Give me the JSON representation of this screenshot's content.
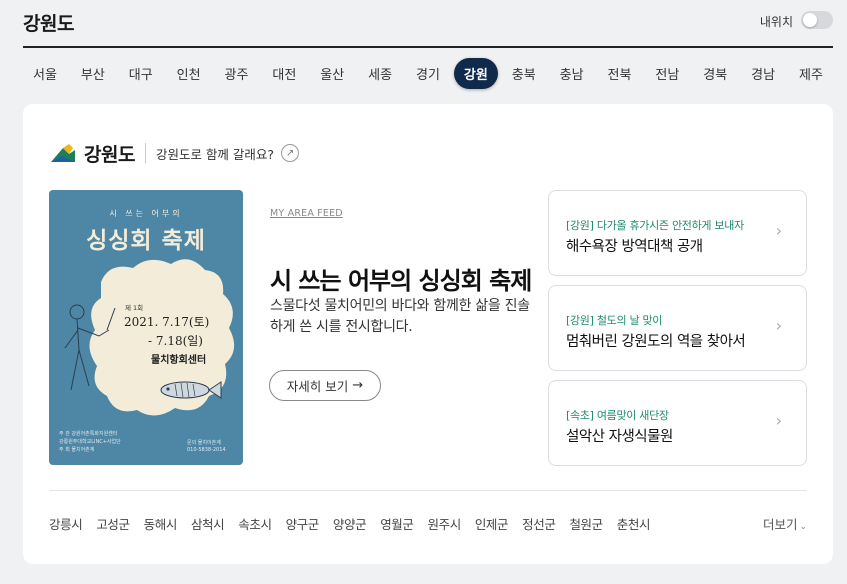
{
  "header": {
    "title": "강원도",
    "location_label": "내위치",
    "location_toggle_on": false
  },
  "regions": [
    {
      "label": "서울",
      "active": false
    },
    {
      "label": "부산",
      "active": false
    },
    {
      "label": "대구",
      "active": false
    },
    {
      "label": "인천",
      "active": false
    },
    {
      "label": "광주",
      "active": false
    },
    {
      "label": "대전",
      "active": false
    },
    {
      "label": "울산",
      "active": false
    },
    {
      "label": "세종",
      "active": false
    },
    {
      "label": "경기",
      "active": false
    },
    {
      "label": "강원",
      "active": true
    },
    {
      "label": "충북",
      "active": false
    },
    {
      "label": "충남",
      "active": false
    },
    {
      "label": "전북",
      "active": false
    },
    {
      "label": "전남",
      "active": false
    },
    {
      "label": "경북",
      "active": false
    },
    {
      "label": "경남",
      "active": false
    },
    {
      "label": "제주",
      "active": false
    }
  ],
  "brand": {
    "name": "강원도",
    "question": "강원도로 함께 갈래요?",
    "logo_icon": "gangwon-logo-icon",
    "go_icon": "arrow-circle-icon"
  },
  "poster": {
    "subtitle": "시 쓰는 어부의",
    "title": "싱싱회 축제",
    "round": "제 1회",
    "date_line1": "2021. 7.17(토)",
    "date_line2": "- 7.18(일)",
    "venue": "물치항회센터",
    "organizer_lines": [
      "주 관  강원어촌특화지원센터",
      "     강릉원주대학교LINC+사업단",
      "주 최  물치어촌계"
    ],
    "contact_lines": [
      "문의  물치어촌계",
      "010-5838-2014"
    ]
  },
  "feed": {
    "label": "MY AREA FEED",
    "title": "시 쓰는 어부의 싱싱회 축제",
    "description": "스물다섯 물치어민의 바다와 함께한 삶을 진솔하게 쓴 시를 전시합니다.",
    "button_label": "자세히 보기"
  },
  "news": [
    {
      "category": "[강원] 다가올 휴가시즌 안전하게 보내자",
      "headline": "해수욕장 방역대책 공개"
    },
    {
      "category": "[강원] 철도의 날 맞이",
      "headline": "멈춰버린 강원도의 역을 찾아서"
    },
    {
      "category": "[속초] 여름맞이 새단장",
      "headline": "설악산 자생식물원"
    }
  ],
  "cities": [
    "강릉시",
    "고성군",
    "동해시",
    "삼척시",
    "속초시",
    "양구군",
    "양양군",
    "영월군",
    "원주시",
    "인제군",
    "정선군",
    "철원군",
    "춘천시"
  ],
  "more_label": "더보기",
  "colors": {
    "active_region": "#0f2a4a",
    "poster_bg": "#4e86a5",
    "news_category": "#1f8a70"
  }
}
